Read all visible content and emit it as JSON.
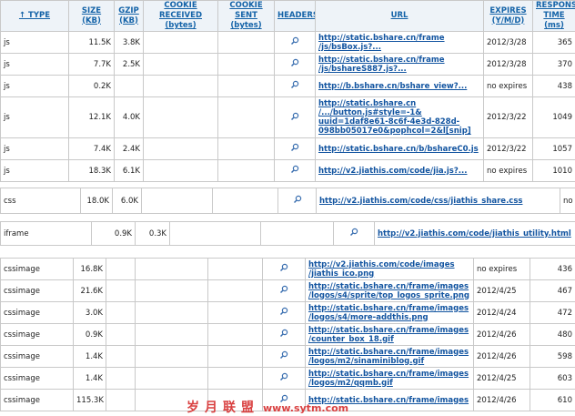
{
  "headers": {
    "type": "↑ TYPE",
    "size": "SIZE (KB)",
    "gzip": "GZIP (KB)",
    "cookie_received": "COOKIE RECEIVED (bytes)",
    "cookie_sent": "COOKIE SENT (bytes)",
    "headers": "HEADERS",
    "url": "URL",
    "expires": "EXPIRES (Y/M/D)",
    "response_time": "RESPONSE TIME (ms)"
  },
  "js_rows": [
    {
      "type": "js",
      "size": "11.5K",
      "gzip": "3.8K",
      "url": "http://static.bshare.cn/frame /js/bsBox.js?...",
      "expires": "2012/3/28",
      "time": "365"
    },
    {
      "type": "js",
      "size": "7.7K",
      "gzip": "2.5K",
      "url": "http://static.bshare.cn/frame /js/bshareS887.js?...",
      "expires": "2012/3/28",
      "time": "370"
    },
    {
      "type": "js",
      "size": "0.2K",
      "gzip": "",
      "url": "http://b.bshare.cn/bshare_view?...",
      "expires": "no expires",
      "time": "438"
    },
    {
      "type": "js",
      "size": "12.1K",
      "gzip": "4.0K",
      "url": "http://static.bshare.cn /.../button.js#style=-1& uuid=1daf8e61-8c6f-4e3d-828d- 098bb05017e0&pophcol=2&l[snip]",
      "expires": "2012/3/22",
      "time": "1049"
    },
    {
      "type": "js",
      "size": "7.4K",
      "gzip": "2.4K",
      "url": "http://static.bshare.cn/b/bshareC0.js",
      "expires": "2012/3/22",
      "time": "1057"
    },
    {
      "type": "js",
      "size": "18.3K",
      "gzip": "6.1K",
      "url": "http://v2.jiathis.com/code/jia.js?...",
      "expires": "no expires",
      "time": "1010"
    }
  ],
  "css_row": {
    "type": "css",
    "size": "18.0K",
    "gzip": "6.0K",
    "url": "http://v2.jiathis.com/code/css/jiathis_share.css",
    "expires": "no e"
  },
  "iframe_row": {
    "type": "iframe",
    "size": "0.9K",
    "gzip": "0.3K",
    "url": "http://v2.jiathis.com/code/jiathis_utility.html"
  },
  "cssimage_rows": [
    {
      "type": "cssimage",
      "size": "16.8K",
      "url": "http://v2.jiathis.com/code/images /jiathis_ico.png",
      "expires": "no expires",
      "time": "436"
    },
    {
      "type": "cssimage",
      "size": "21.6K",
      "url": "http://static.bshare.cn/frame/images /logos/s4/sprite/top_logos_sprite.png",
      "expires": "2012/4/25",
      "time": "467"
    },
    {
      "type": "cssimage",
      "size": "3.0K",
      "url": "http://static.bshare.cn/frame/images /logos/s4/more-addthis.png",
      "expires": "2012/4/24",
      "time": "472"
    },
    {
      "type": "cssimage",
      "size": "0.9K",
      "url": "http://static.bshare.cn/frame/images /counter_box_18.gif",
      "expires": "2012/4/26",
      "time": "480"
    },
    {
      "type": "cssimage",
      "size": "1.4K",
      "url": "http://static.bshare.cn/frame/images /logos/m2/sinaminiblog.gif",
      "expires": "2012/4/26",
      "time": "598"
    },
    {
      "type": "cssimage",
      "size": "1.4K",
      "url": "http://static.bshare.cn/frame/images /logos/m2/qqmb.gif",
      "expires": "2012/4/25",
      "time": "603"
    },
    {
      "type": "cssimage",
      "size": "115.3K",
      "url": "http://static.bshare.cn/frame/images",
      "expires": "2012/4/26",
      "time": "610"
    }
  ],
  "watermark": {
    "text": "岁月联盟",
    "domain": "www.sytm.com"
  },
  "icons": {
    "headers_cell": "magnifier-icon"
  }
}
